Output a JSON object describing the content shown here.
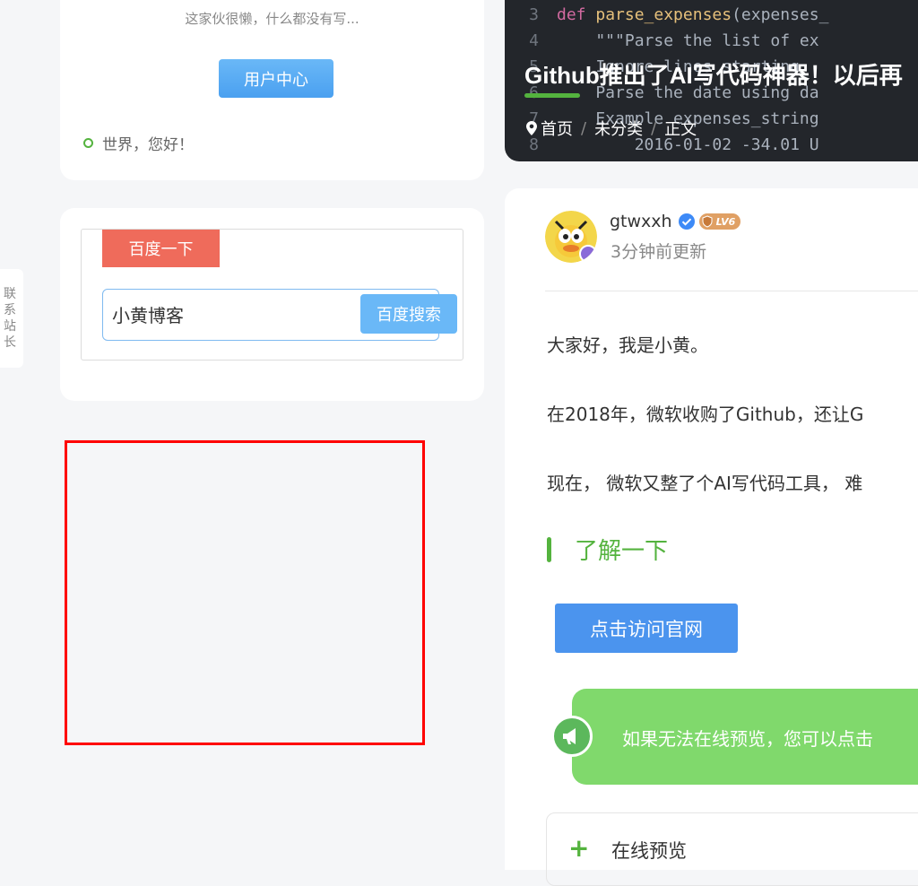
{
  "profile": {
    "bio": "这家伙很懒，什么都没有写...",
    "user_center_label": "用户中心",
    "recent_post": "世界，您好！"
  },
  "search_widget": {
    "tag_label": "百度一下",
    "input_value": "小黄博客",
    "button_label": "百度搜索"
  },
  "contact_tab": {
    "chars": [
      "联",
      "系",
      "站",
      "长"
    ]
  },
  "hero": {
    "code_lines": [
      {
        "n": "3",
        "kw": "def ",
        "fn": "parse_expenses",
        "rest": "(expenses_"
      },
      {
        "n": "4",
        "kw": "",
        "fn": "",
        "rest": "    \"\"\"Parse the list of ex"
      },
      {
        "n": "5",
        "kw": "",
        "fn": "",
        "rest": "    Ignore lines starting"
      },
      {
        "n": "6",
        "kw": "",
        "fn": "",
        "rest": "    Parse the date using da"
      },
      {
        "n": "7",
        "kw": "",
        "fn": "",
        "rest": "    Example expenses_string"
      },
      {
        "n": "8",
        "kw": "",
        "fn": "",
        "rest": "        2016-01-02 -34.01 U"
      }
    ],
    "title": "Github推出了AI写代码神器！以后再",
    "breadcrumb": [
      "首页",
      "未分类",
      "正文"
    ],
    "breadcrumb_sep": "/"
  },
  "article": {
    "author": "gtwxxh",
    "level": "LV6",
    "updated": "3分钟前更新",
    "paragraphs": [
      "大家好，我是小黄。",
      "在2018年，微软收购了Github，还让G",
      "现在， 微软又整了个AI写代码工具， 难"
    ],
    "section_heading": "了解一下",
    "visit_button": "点击访问官网",
    "notice_text": "如果无法在线预览，您可以点击",
    "preview_label": "在线预览",
    "preview_plus": "+"
  },
  "colors": {
    "accent_green": "#54b33e",
    "button_blue": "#4b94ee",
    "search_tag_red": "#ef6b5b",
    "notice_green": "#80d96c"
  }
}
